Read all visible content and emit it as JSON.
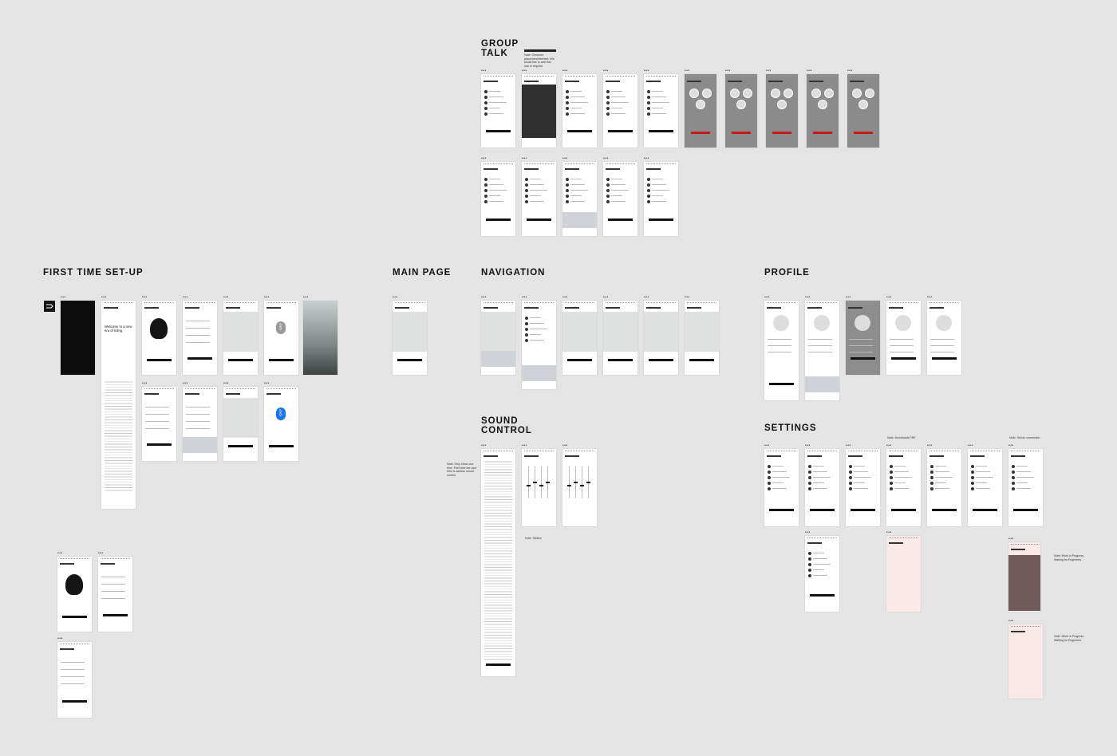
{
  "sections": {
    "group_talk": "GROUP\nTALK",
    "first_time_setup": "FIRST TIME SET-UP",
    "main_page": "MAIN PAGE",
    "navigation": "NAVIGATION",
    "profile": "PROFILE",
    "sound_control": "SOUND\nCONTROL",
    "settings": "SETTINGS"
  },
  "notes": {
    "group_talk": "Note: Choosen placement/element. We would like to add this one to request",
    "sound_control_first": "Note: Only show one time. First time the user tries to access sound control",
    "sound_control_sliders": "Note: Sliders",
    "settings_pdf": "Note: Downloads PDF",
    "settings_server": "Note: Server connection",
    "settings_wip_1": "Note: Work in Progress, Waiting for Engineers",
    "settings_wip_2": "Note: Work in Progress, Waiting for Engineers"
  },
  "frames": {
    "frame_label": "•••",
    "welcome_text": "Welcome to a new era of riding.",
    "bluetooth_glyph": "ᛒ"
  },
  "colors": {
    "canvas": "#e4e4e4",
    "accent_red": "#c21a1a",
    "accent_lime": "#d4ec2a",
    "bluetooth_blue": "#1a73e8",
    "wip_pink": "#fbe9ea"
  }
}
